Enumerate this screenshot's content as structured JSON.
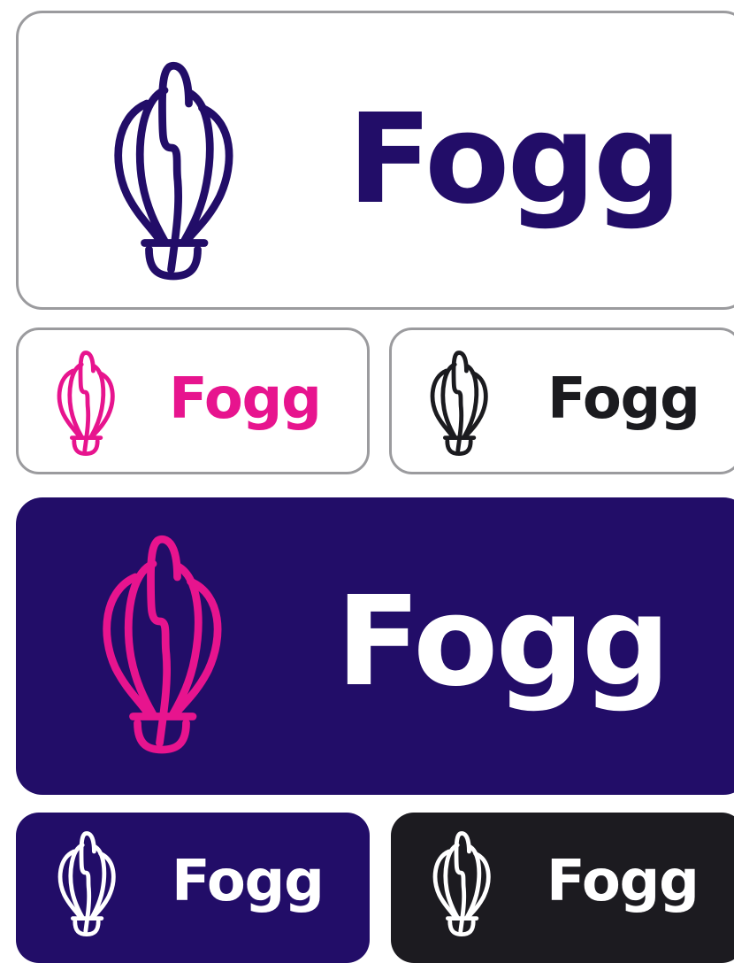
{
  "brand": {
    "name": "Fogg"
  },
  "colors": {
    "navy": "#220d68",
    "pink": "#e7148e",
    "black": "#1b1b1f",
    "white": "#ffffff",
    "outline_gray": "#9b9b9e",
    "dark_card": "#1c1b20"
  },
  "logo_variants": [
    {
      "wordmark": "Fogg",
      "icon": "hot-air-balloon-icon",
      "background": "#ffffff",
      "icon_color": "#220d68",
      "text_color": "#220d68",
      "outlined": true
    },
    {
      "wordmark": "Fogg",
      "icon": "hot-air-balloon-icon",
      "background": "#ffffff",
      "icon_color": "#e7148e",
      "text_color": "#e7148e",
      "outlined": true
    },
    {
      "wordmark": "Fogg",
      "icon": "hot-air-balloon-icon",
      "background": "#ffffff",
      "icon_color": "#1b1b1f",
      "text_color": "#1b1b1f",
      "outlined": true
    },
    {
      "wordmark": "Fogg",
      "icon": "hot-air-balloon-icon",
      "background": "#220d68",
      "icon_color": "#e7148e",
      "text_color": "#ffffff",
      "outlined": false
    },
    {
      "wordmark": "Fogg",
      "icon": "hot-air-balloon-icon",
      "background": "#220d68",
      "icon_color": "#ffffff",
      "text_color": "#ffffff",
      "outlined": false
    },
    {
      "wordmark": "Fogg",
      "icon": "hot-air-balloon-icon",
      "background": "#1c1b20",
      "icon_color": "#ffffff",
      "text_color": "#ffffff",
      "outlined": false
    }
  ]
}
